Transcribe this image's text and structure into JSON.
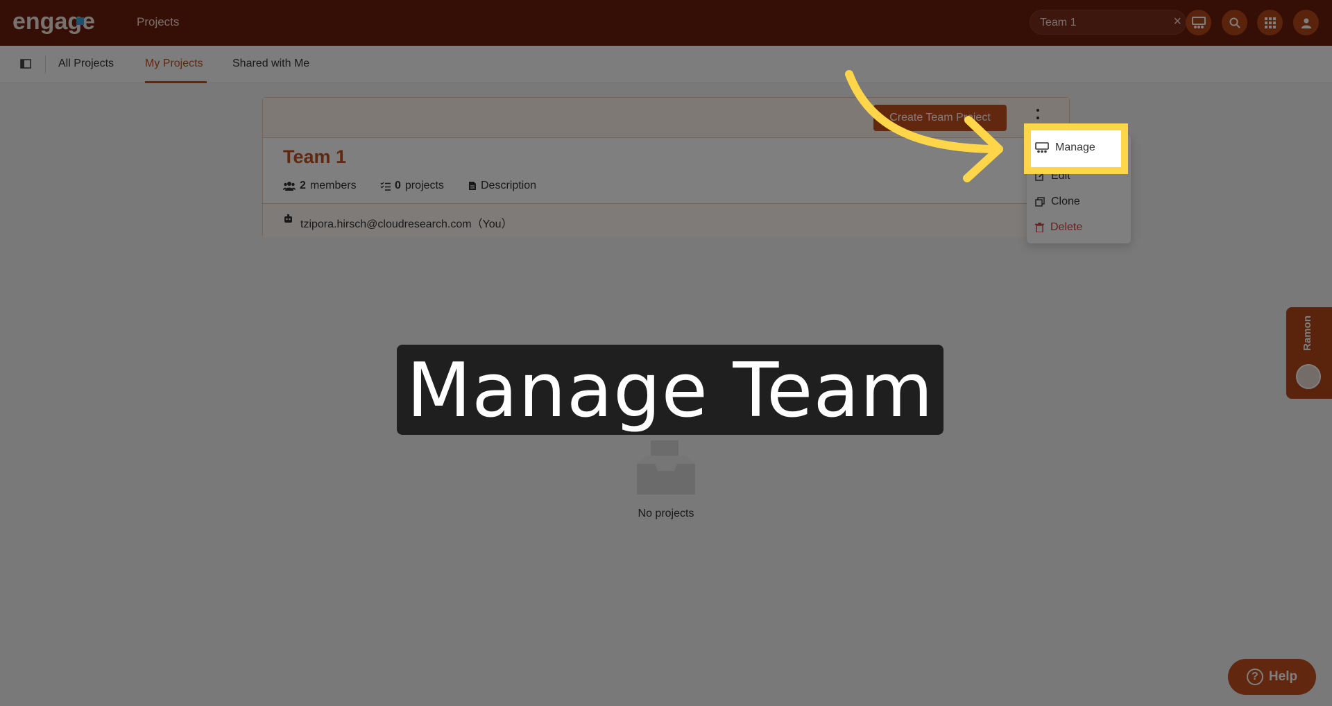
{
  "topbar": {
    "logo_text": "engage",
    "title": "Projects",
    "team_search_value": "Team 1"
  },
  "subnav": {
    "tabs": [
      {
        "label": "All Projects"
      },
      {
        "label": "My Projects"
      },
      {
        "label": "Shared with Me"
      }
    ],
    "active_tab": "My Projects"
  },
  "team_card": {
    "create_button": "Create Team Project",
    "name": "Team 1",
    "members_count": "2",
    "members_label": "members",
    "projects_count": "0",
    "projects_label": "projects",
    "description_label": "Description",
    "member_email": "tzipora.hirsch@cloudresearch.com（You）"
  },
  "menu": {
    "items": [
      {
        "label": "Manage"
      },
      {
        "label": "Edit"
      },
      {
        "label": "Clone"
      },
      {
        "label": "Delete"
      }
    ]
  },
  "empty_state": {
    "text": "No projects"
  },
  "caption": {
    "text": "Manage Team"
  },
  "side_widget": {
    "name": "Ramon"
  },
  "help": {
    "label": "Help"
  },
  "colors": {
    "brand_dark": "#6b1d0c",
    "accent": "#c2501f",
    "highlight": "#ffd54a",
    "danger": "#d9363e"
  }
}
